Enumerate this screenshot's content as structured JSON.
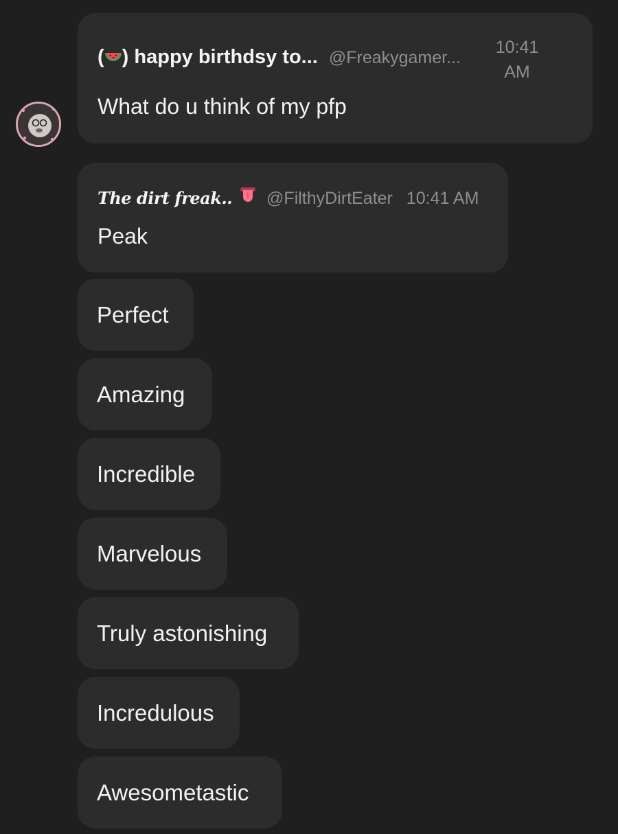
{
  "messages": [
    {
      "author_prefix": "(",
      "author_emoji": "watermelon-icon",
      "author_suffix": ") happy birthdsy to...",
      "handle": "@Freakygamer...",
      "time_line1": "10:41",
      "time_line2": "AM",
      "text": "What do u think of my pfp"
    },
    {
      "author": "The dirt freak..",
      "author_emoji": "tongue-icon",
      "handle": "@FilthyDirtEater",
      "time": "10:41 AM",
      "text": "Peak"
    }
  ],
  "followups": [
    "Perfect",
    "Amazing",
    "Incredible",
    "Marvelous",
    "Truly astonishing",
    "Incredulous",
    "Awesometastic"
  ],
  "colors": {
    "background": "#1f1f1f",
    "bubble": "#2c2c2c",
    "muted_text": "#8e8e8e",
    "text": "#f2f2f2",
    "avatar_ring": "#d9a6b4"
  }
}
